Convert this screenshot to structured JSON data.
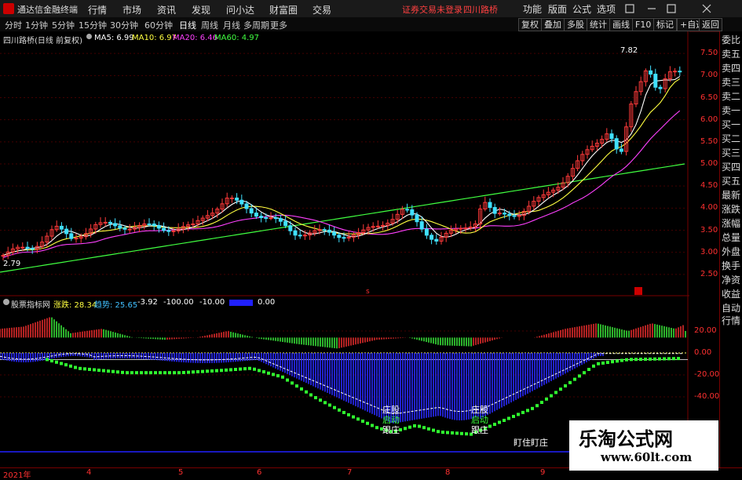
{
  "app": {
    "title": "通达信金融终端"
  },
  "menu": [
    "行情",
    "市场",
    "资讯",
    "发现",
    "问小达",
    "财富圈",
    "交易"
  ],
  "header_warning": "证券交易未登录",
  "header_stock": "四川路桥",
  "top_right": [
    "功能",
    "版面",
    "公式",
    "选项"
  ],
  "periods": [
    "分时",
    "1分钟",
    "5分钟",
    "15分钟",
    "30分钟",
    "60分钟",
    "日线",
    "周线",
    "月线",
    "多周期",
    "更多"
  ],
  "active_period": "日线",
  "right_buttons": [
    "复权",
    "叠加",
    "多股",
    "统计",
    "画线",
    "F10",
    "标记",
    "+自选",
    "返回"
  ],
  "stock_line": "四川路桥(日线 前复权)",
  "ma": [
    {
      "label": "MA5: 6.99",
      "color": "#ffffff"
    },
    {
      "label": "MA10: 6.97",
      "color": "#ffff40"
    },
    {
      "label": "MA20: 6.46",
      "color": "#ff40ff"
    },
    {
      "label": "MA60: 4.97",
      "color": "#40ff40"
    }
  ],
  "price_ticks": [
    "7.50",
    "7.00",
    "6.50",
    "6.00",
    "5.50",
    "5.00",
    "4.50",
    "4.00",
    "3.50",
    "3.00",
    "2.50"
  ],
  "price_high_label": "7.82",
  "price_low_label": "2.79",
  "indicator": {
    "name": "股票指标网",
    "items": [
      {
        "label": "涨跌: 28.34",
        "color": "#ffff40"
      },
      {
        "label": "趋势: 25.65",
        "color": "#40c0ff"
      },
      {
        "label": "-3.92",
        "color": "#ffffff"
      },
      {
        "label": "-100.00",
        "color": "#ffffff"
      },
      {
        "label": "-10.00",
        "color": "#ffffff"
      },
      {
        "label": "0.00",
        "color": "#ffffff"
      }
    ]
  },
  "sub_ticks": [
    "20.00",
    "0.00",
    "-20.00",
    "-40.00"
  ],
  "notes": [
    {
      "l1": "庄股",
      "l2": "启动",
      "l3": "跟庄"
    },
    {
      "l1": "庄股",
      "l2": "启动",
      "l3": "跟庄"
    }
  ],
  "note3": "盯住盯庄",
  "right_panel": [
    "委比",
    "卖五",
    "卖四",
    "卖三",
    "卖二",
    "卖一",
    "买一",
    "买二",
    "买三",
    "买四",
    "买五",
    "最新",
    "涨跌",
    "涨幅",
    "总量",
    "外盘",
    "换手",
    "净资",
    "收益"
  ],
  "right_panel2": [
    "自动",
    "行情"
  ],
  "dates": [
    "2021年",
    "4",
    "5",
    "6",
    "7",
    "8",
    "9"
  ],
  "watermark": {
    "line1": "乐淘公式网",
    "line2": "www.60lt.com"
  }
}
